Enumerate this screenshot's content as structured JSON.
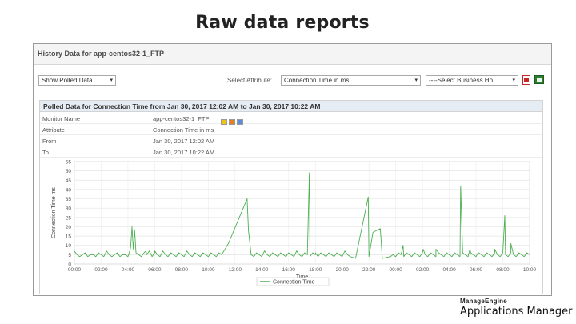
{
  "slide": {
    "title": "Raw data reports"
  },
  "window": {
    "title": "History Data for app-centos32-1_FTP",
    "show_select": "Show Polled Data",
    "attribute_label": "Select Attribute:",
    "attribute_select": "Connection Time in ms",
    "business_select": "----Select Business Ho",
    "icons": [
      "pdf-icon",
      "excel-icon"
    ]
  },
  "panel": {
    "title": "Polled Data for Connection Time from Jan 30, 2017 12:02 AM to Jan 30, 2017 10:22 AM",
    "rows": [
      {
        "key": "Monitor Name",
        "value": "app-centos32-1_FTP"
      },
      {
        "key": "Attribute",
        "value": "Connection Time in ms"
      },
      {
        "key": "From",
        "value": "Jan 30, 2017 12:02 AM"
      },
      {
        "key": "To",
        "value": "Jan 30, 2017 10:22 AM"
      }
    ],
    "monitor_icons": [
      "folder-icon",
      "settings-icon",
      "report-icon"
    ]
  },
  "chart_data": {
    "type": "line",
    "xlabel": "Time",
    "ylabel": "Connection Time ms",
    "ylim": [
      0,
      55
    ],
    "yticks": [
      0,
      5,
      10,
      15,
      20,
      25,
      30,
      35,
      40,
      45,
      50,
      55
    ],
    "xticks": [
      "00:00",
      "02:00",
      "04:00",
      "06:00",
      "08:00",
      "10:00",
      "12:00",
      "14:00",
      "16:00",
      "18:00",
      "20:00",
      "22:00",
      "00:00",
      "02:00",
      "04:00",
      "06:00",
      "08:00",
      "10:00"
    ],
    "x_range": [
      0,
      34
    ],
    "grid": true,
    "legend_position": "bottom-center",
    "series": [
      {
        "name": "Connection Time",
        "color": "#4caf50",
        "points": [
          [
            0.0,
            7
          ],
          [
            0.2,
            5
          ],
          [
            0.4,
            4
          ],
          [
            0.6,
            5
          ],
          [
            0.8,
            6
          ],
          [
            1.0,
            4
          ],
          [
            1.2,
            5
          ],
          [
            1.4,
            5
          ],
          [
            1.6,
            4
          ],
          [
            1.8,
            6
          ],
          [
            2.0,
            5
          ],
          [
            2.2,
            4
          ],
          [
            2.4,
            7
          ],
          [
            2.6,
            5
          ],
          [
            2.8,
            4
          ],
          [
            3.0,
            5
          ],
          [
            3.2,
            6
          ],
          [
            3.4,
            4
          ],
          [
            3.6,
            5
          ],
          [
            3.8,
            5
          ],
          [
            4.0,
            4
          ],
          [
            4.1,
            6
          ],
          [
            4.2,
            9
          ],
          [
            4.3,
            20
          ],
          [
            4.4,
            8
          ],
          [
            4.5,
            18
          ],
          [
            4.6,
            6
          ],
          [
            4.8,
            5
          ],
          [
            5.0,
            4
          ],
          [
            5.2,
            6
          ],
          [
            5.4,
            5
          ],
          [
            5.6,
            7
          ],
          [
            5.8,
            4
          ],
          [
            6.0,
            6
          ],
          [
            6.2,
            5
          ],
          [
            6.4,
            4
          ],
          [
            6.6,
            7
          ],
          [
            6.8,
            5
          ],
          [
            7.0,
            4
          ],
          [
            7.2,
            6
          ],
          [
            7.4,
            5
          ],
          [
            7.6,
            4
          ],
          [
            7.8,
            6
          ],
          [
            8.0,
            5
          ],
          [
            8.2,
            4
          ],
          [
            8.4,
            7
          ],
          [
            8.6,
            5
          ],
          [
            8.8,
            4
          ],
          [
            9.0,
            6
          ],
          [
            9.2,
            5
          ],
          [
            9.4,
            4
          ],
          [
            9.6,
            6
          ],
          [
            9.8,
            5
          ],
          [
            10.0,
            4
          ],
          [
            10.2,
            6
          ],
          [
            10.4,
            5
          ],
          [
            10.6,
            4
          ],
          [
            10.8,
            6
          ],
          [
            11.0,
            5
          ],
          [
            13.0,
            18
          ],
          [
            13.2,
            5
          ],
          [
            13.4,
            4
          ],
          [
            13.6,
            6
          ],
          [
            13.8,
            5
          ],
          [
            14.0,
            4
          ],
          [
            14.2,
            7
          ],
          [
            14.4,
            5
          ],
          [
            14.6,
            4
          ],
          [
            14.8,
            6
          ],
          [
            15.0,
            5
          ],
          [
            15.2,
            4
          ],
          [
            15.4,
            6
          ],
          [
            15.6,
            5
          ],
          [
            15.8,
            4
          ],
          [
            16.0,
            6
          ],
          [
            16.2,
            5
          ],
          [
            16.4,
            4
          ],
          [
            16.6,
            7
          ],
          [
            16.8,
            5
          ],
          [
            17.0,
            4
          ],
          [
            17.2,
            6
          ],
          [
            17.4,
            5
          ],
          [
            17.6,
            4
          ],
          [
            17.8,
            6
          ],
          [
            18.0,
            5
          ],
          [
            18.2,
            4
          ],
          [
            18.4,
            6
          ],
          [
            18.6,
            5
          ],
          [
            18.8,
            4
          ],
          [
            19.0,
            6
          ],
          [
            19.2,
            5
          ],
          [
            19.4,
            4
          ],
          [
            19.6,
            6
          ],
          [
            19.8,
            5
          ],
          [
            20.0,
            4
          ],
          [
            20.2,
            7
          ],
          [
            20.4,
            5
          ],
          [
            20.6,
            4
          ],
          [
            21.0,
            3
          ],
          [
            22.0,
            4
          ],
          [
            23.0,
            3
          ],
          [
            23.6,
            4
          ],
          [
            23.8,
            5
          ],
          [
            24.0,
            4
          ],
          [
            24.2,
            6
          ],
          [
            24.4,
            5
          ],
          [
            24.6,
            4
          ],
          [
            24.8,
            6
          ],
          [
            25.0,
            5
          ],
          [
            25.2,
            4
          ],
          [
            25.4,
            6
          ],
          [
            25.6,
            5
          ],
          [
            25.8,
            4
          ],
          [
            26.0,
            6
          ],
          [
            26.2,
            5
          ],
          [
            26.4,
            4
          ],
          [
            26.6,
            6
          ],
          [
            26.8,
            5
          ],
          [
            27.0,
            4
          ],
          [
            27.2,
            6
          ],
          [
            27.4,
            5
          ],
          [
            27.6,
            4
          ],
          [
            27.8,
            6
          ],
          [
            28.0,
            5
          ],
          [
            28.2,
            4
          ],
          [
            28.4,
            6
          ],
          [
            28.6,
            5
          ],
          [
            28.8,
            4
          ],
          [
            29.0,
            6
          ],
          [
            29.2,
            5
          ],
          [
            29.4,
            4
          ],
          [
            29.6,
            6
          ],
          [
            29.8,
            5
          ],
          [
            30.0,
            4
          ],
          [
            30.2,
            6
          ],
          [
            30.4,
            5
          ],
          [
            30.6,
            4
          ],
          [
            30.8,
            6
          ],
          [
            31.0,
            5
          ],
          [
            31.2,
            4
          ],
          [
            31.4,
            6
          ],
          [
            31.6,
            5
          ],
          [
            31.8,
            4
          ],
          [
            32.0,
            6
          ],
          [
            32.2,
            5
          ],
          [
            32.4,
            4
          ],
          [
            32.6,
            6
          ],
          [
            32.8,
            5
          ],
          [
            33.0,
            4
          ],
          [
            33.2,
            6
          ],
          [
            33.4,
            5
          ],
          [
            33.6,
            4
          ],
          [
            33.8,
            6
          ],
          [
            34.0,
            5
          ]
        ],
        "spikes": [
          [
            5.35,
            7
          ],
          [
            6.0,
            7
          ],
          [
            11.5,
            11
          ],
          [
            12.9,
            35
          ],
          [
            17.55,
            49
          ],
          [
            18.0,
            6
          ],
          [
            21.95,
            36
          ],
          [
            22.3,
            17
          ],
          [
            22.85,
            19
          ],
          [
            24.55,
            10
          ],
          [
            26.05,
            8
          ],
          [
            27.0,
            8
          ],
          [
            28.85,
            42
          ],
          [
            29.55,
            8
          ],
          [
            30.15,
            6
          ],
          [
            31.4,
            8
          ],
          [
            32.15,
            26
          ],
          [
            32.6,
            11
          ]
        ]
      }
    ]
  },
  "logo": {
    "top": "ManageEngine",
    "bottom": "Applications Manager"
  }
}
